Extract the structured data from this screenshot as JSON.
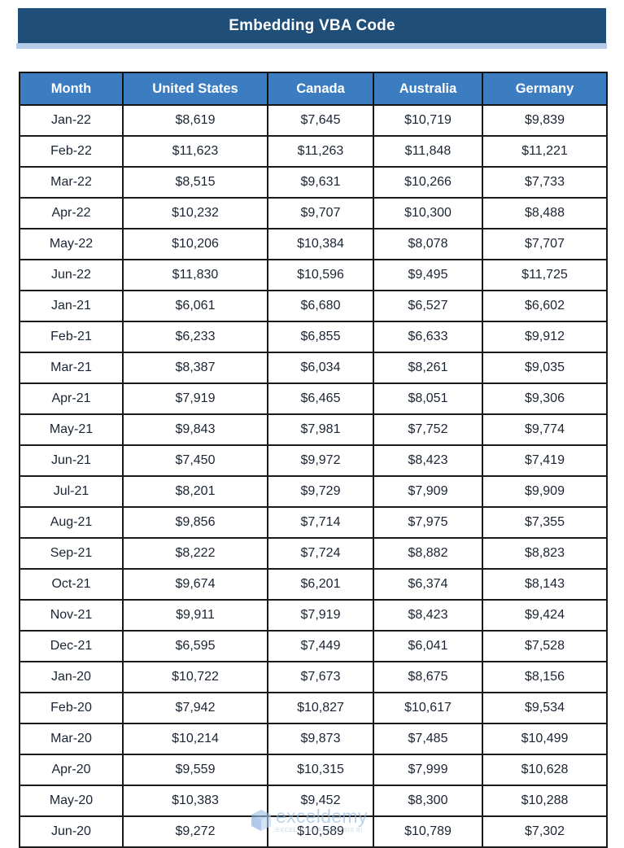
{
  "banner": {
    "title": "Embedding VBA Code",
    "bar_color": "#1F4E79",
    "under_color": "#B4CBE7"
  },
  "table": {
    "header_color": "#3C7CC0",
    "header_text_color": "#FFFFFF",
    "border_color": "#1A1A1A",
    "columns": [
      "Month",
      "United States",
      "Canada",
      "Australia",
      "Germany"
    ],
    "rows": [
      {
        "month": "Jan-22",
        "united_states": "$8,619",
        "canada": "$7,645",
        "australia": "$10,719",
        "germany": "$9,839"
      },
      {
        "month": "Feb-22",
        "united_states": "$11,623",
        "canada": "$11,263",
        "australia": "$11,848",
        "germany": "$11,221"
      },
      {
        "month": "Mar-22",
        "united_states": "$8,515",
        "canada": "$9,631",
        "australia": "$10,266",
        "germany": "$7,733"
      },
      {
        "month": "Apr-22",
        "united_states": "$10,232",
        "canada": "$9,707",
        "australia": "$10,300",
        "germany": "$8,488"
      },
      {
        "month": "May-22",
        "united_states": "$10,206",
        "canada": "$10,384",
        "australia": "$8,078",
        "germany": "$7,707"
      },
      {
        "month": "Jun-22",
        "united_states": "$11,830",
        "canada": "$10,596",
        "australia": "$9,495",
        "germany": "$11,725"
      },
      {
        "month": "Jan-21",
        "united_states": "$6,061",
        "canada": "$6,680",
        "australia": "$6,527",
        "germany": "$6,602"
      },
      {
        "month": "Feb-21",
        "united_states": "$6,233",
        "canada": "$6,855",
        "australia": "$6,633",
        "germany": "$9,912"
      },
      {
        "month": "Mar-21",
        "united_states": "$8,387",
        "canada": "$6,034",
        "australia": "$8,261",
        "germany": "$9,035"
      },
      {
        "month": "Apr-21",
        "united_states": "$7,919",
        "canada": "$6,465",
        "australia": "$8,051",
        "germany": "$9,306"
      },
      {
        "month": "May-21",
        "united_states": "$9,843",
        "canada": "$7,981",
        "australia": "$7,752",
        "germany": "$9,774"
      },
      {
        "month": "Jun-21",
        "united_states": "$7,450",
        "canada": "$9,972",
        "australia": "$8,423",
        "germany": "$7,419"
      },
      {
        "month": "Jul-21",
        "united_states": "$8,201",
        "canada": "$9,729",
        "australia": "$7,909",
        "germany": "$9,909"
      },
      {
        "month": "Aug-21",
        "united_states": "$9,856",
        "canada": "$7,714",
        "australia": "$7,975",
        "germany": "$7,355"
      },
      {
        "month": "Sep-21",
        "united_states": "$8,222",
        "canada": "$7,724",
        "australia": "$8,882",
        "germany": "$8,823"
      },
      {
        "month": "Oct-21",
        "united_states": "$9,674",
        "canada": "$6,201",
        "australia": "$6,374",
        "germany": "$8,143"
      },
      {
        "month": "Nov-21",
        "united_states": "$9,911",
        "canada": "$7,919",
        "australia": "$8,423",
        "germany": "$9,424"
      },
      {
        "month": "Dec-21",
        "united_states": "$6,595",
        "canada": "$7,449",
        "australia": "$6,041",
        "germany": "$7,528"
      },
      {
        "month": "Jan-20",
        "united_states": "$10,722",
        "canada": "$7,673",
        "australia": "$8,675",
        "germany": "$8,156"
      },
      {
        "month": "Feb-20",
        "united_states": "$7,942",
        "canada": "$10,827",
        "australia": "$10,617",
        "germany": "$9,534"
      },
      {
        "month": "Mar-20",
        "united_states": "$10,214",
        "canada": "$9,873",
        "australia": "$7,485",
        "germany": "$10,499"
      },
      {
        "month": "Apr-20",
        "united_states": "$9,559",
        "canada": "$10,315",
        "australia": "$7,999",
        "germany": "$10,628"
      },
      {
        "month": "May-20",
        "united_states": "$10,383",
        "canada": "$9,452",
        "australia": "$8,300",
        "germany": "$10,288"
      },
      {
        "month": "Jun-20",
        "united_states": "$9,272",
        "canada": "$10,589",
        "australia": "$10,789",
        "germany": "$7,302"
      }
    ]
  },
  "watermark": {
    "brand": "exceldemy",
    "tagline": "EXCEL & DATA ANALYSIS BI",
    "logo_icon": "cube-logo-icon",
    "brand_color": "#8FB8E0"
  }
}
